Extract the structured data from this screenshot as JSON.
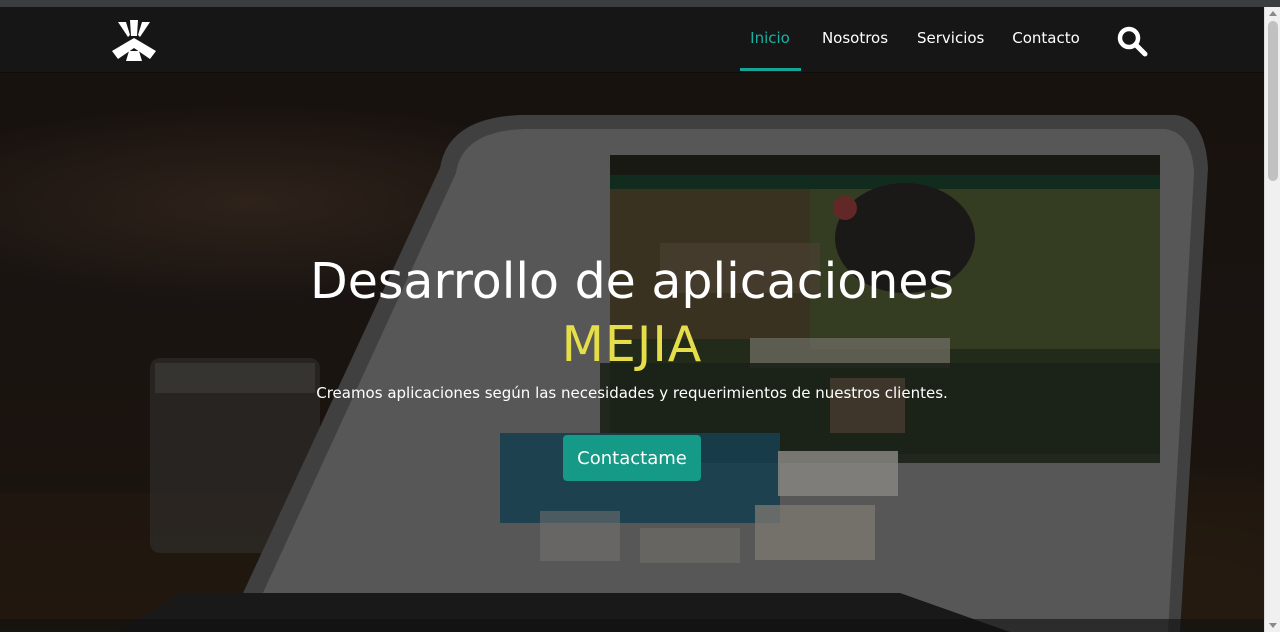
{
  "nav": {
    "logo_icon": "brand-logo-icon",
    "items": [
      {
        "label": "Inicio",
        "active": true
      },
      {
        "label": "Nosotros",
        "active": false
      },
      {
        "label": "Servicios",
        "active": false
      },
      {
        "label": "Contacto",
        "active": false
      }
    ],
    "search_icon": "search-icon"
  },
  "hero": {
    "title": "Desarrollo de aplicaciones",
    "brand": "MEJIA",
    "subtitle": "Creamos aplicaciones según las necesidades y requerimientos de nuestros clientes.",
    "cta_label": "Contactame",
    "background": "laptop-on-desk-photo"
  },
  "colors": {
    "accent": "#19b1a1",
    "button": "#149a86",
    "brand_text": "#e5dd4a",
    "navbar": "#161616"
  }
}
